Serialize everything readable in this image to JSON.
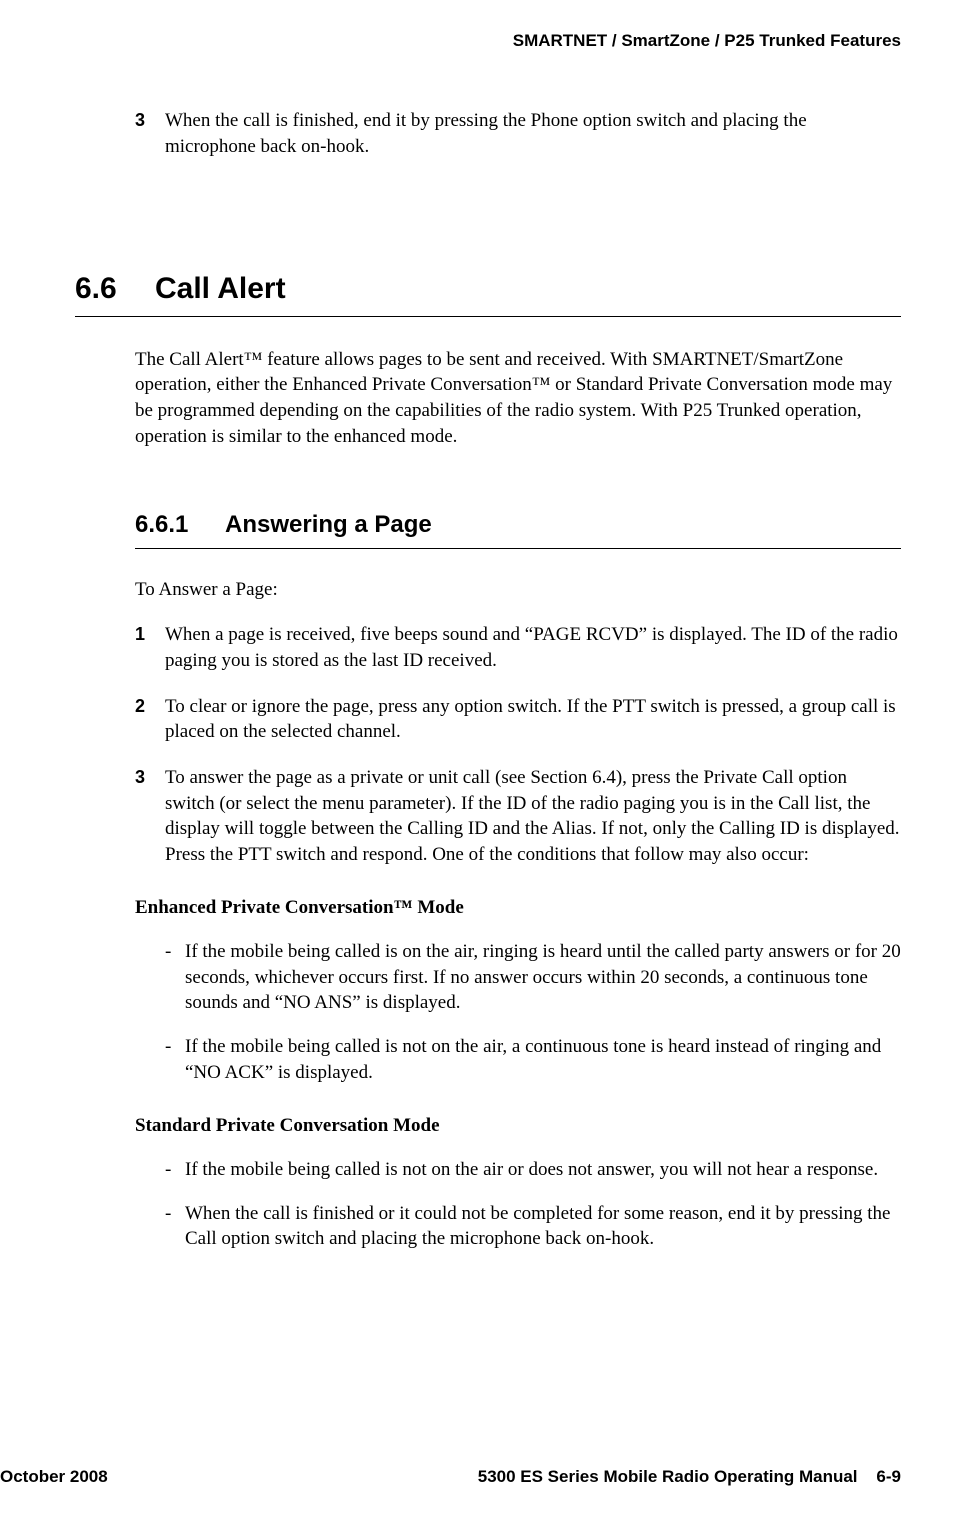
{
  "header": {
    "title": "SMARTNET / SmartZone / P25 Trunked Features"
  },
  "topStep": {
    "num": "3",
    "text": "When the call is finished, end it by pressing the Phone option switch and placing the microphone back on-hook."
  },
  "section": {
    "num": "6.6",
    "title": "Call Alert",
    "intro": "The Call Alert™ feature allows pages to be sent and received. With SMARTNET/SmartZone operation, either the Enhanced Private Conversation™ or Standard Private Conversation mode may be programmed depending on the capabilities of the radio system. With P25 Trunked operation, operation is similar to the enhanced mode."
  },
  "subsection": {
    "num": "6.6.1",
    "title": "Answering a Page",
    "lead": "To Answer a Page:",
    "steps": [
      {
        "num": "1",
        "text": "When a page is received, five beeps sound and “PAGE RCVD” is displayed. The ID of the radio paging you is stored as the last ID received."
      },
      {
        "num": "2",
        "text": "To clear or ignore the page, press any option switch. If the PTT switch is pressed, a group call is placed on the selected channel."
      },
      {
        "num": "3",
        "text": "To answer the page as a private or unit call (see Section 6.4), press the Private Call option switch (or select the menu parameter). If the ID of the radio paging you is in the Call list, the display will toggle between the Calling ID and the Alias. If not, only the Calling ID is displayed. Press the PTT switch and respond. One of the conditions that follow may also occur:"
      }
    ],
    "mode1": {
      "heading": "Enhanced Private Conversation™ Mode",
      "items": [
        "If the mobile being called is on the air, ringing is heard until the called party answers or for 20 seconds, whichever occurs first. If no answer occurs within 20 seconds, a continuous tone sounds and “NO ANS” is displayed.",
        "If the mobile being called is not on the air, a continuous tone is heard instead of ringing and “NO ACK” is displayed."
      ]
    },
    "mode2": {
      "heading": "Standard Private Conversation Mode",
      "items": [
        "If the mobile being called is not on the air or does not answer, you will not hear a response.",
        "When the call is finished or it could not be completed for some reason, end it by pressing the Call option switch and placing the microphone back on-hook."
      ]
    }
  },
  "footer": {
    "left": "October 2008",
    "right_manual": "5300 ES Series Mobile Radio Operating Manual",
    "right_page": "6-9"
  }
}
